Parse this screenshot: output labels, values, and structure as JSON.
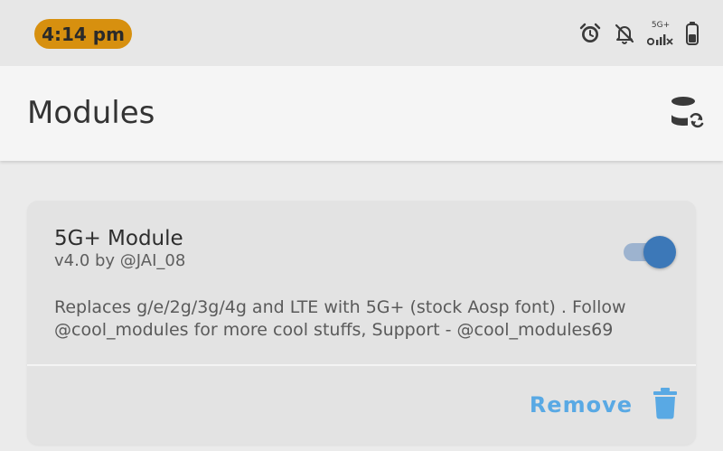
{
  "status_bar": {
    "time": "4:14 pm",
    "network_label": "5G+",
    "icons": [
      "alarm-icon",
      "notifications-off-icon",
      "signal-5g-icon",
      "battery-icon"
    ]
  },
  "header": {
    "title": "Modules",
    "action_icon": "database-sync-icon"
  },
  "module": {
    "name": "5G+ Module",
    "version": "v4.0 by @JAI_08",
    "description": "Replaces g/e/2g/3g/4g and LTE with 5G+ (stock Aosp font) . Follow @cool_modules for more cool stuffs, Support - @cool_modules69",
    "enabled": true,
    "remove_label": "Remove"
  },
  "colors": {
    "time_pill": "#d7900f",
    "accent_blue": "#59a9e4",
    "toggle_thumb": "#3c78b8",
    "toggle_track": "#9db3cf"
  }
}
